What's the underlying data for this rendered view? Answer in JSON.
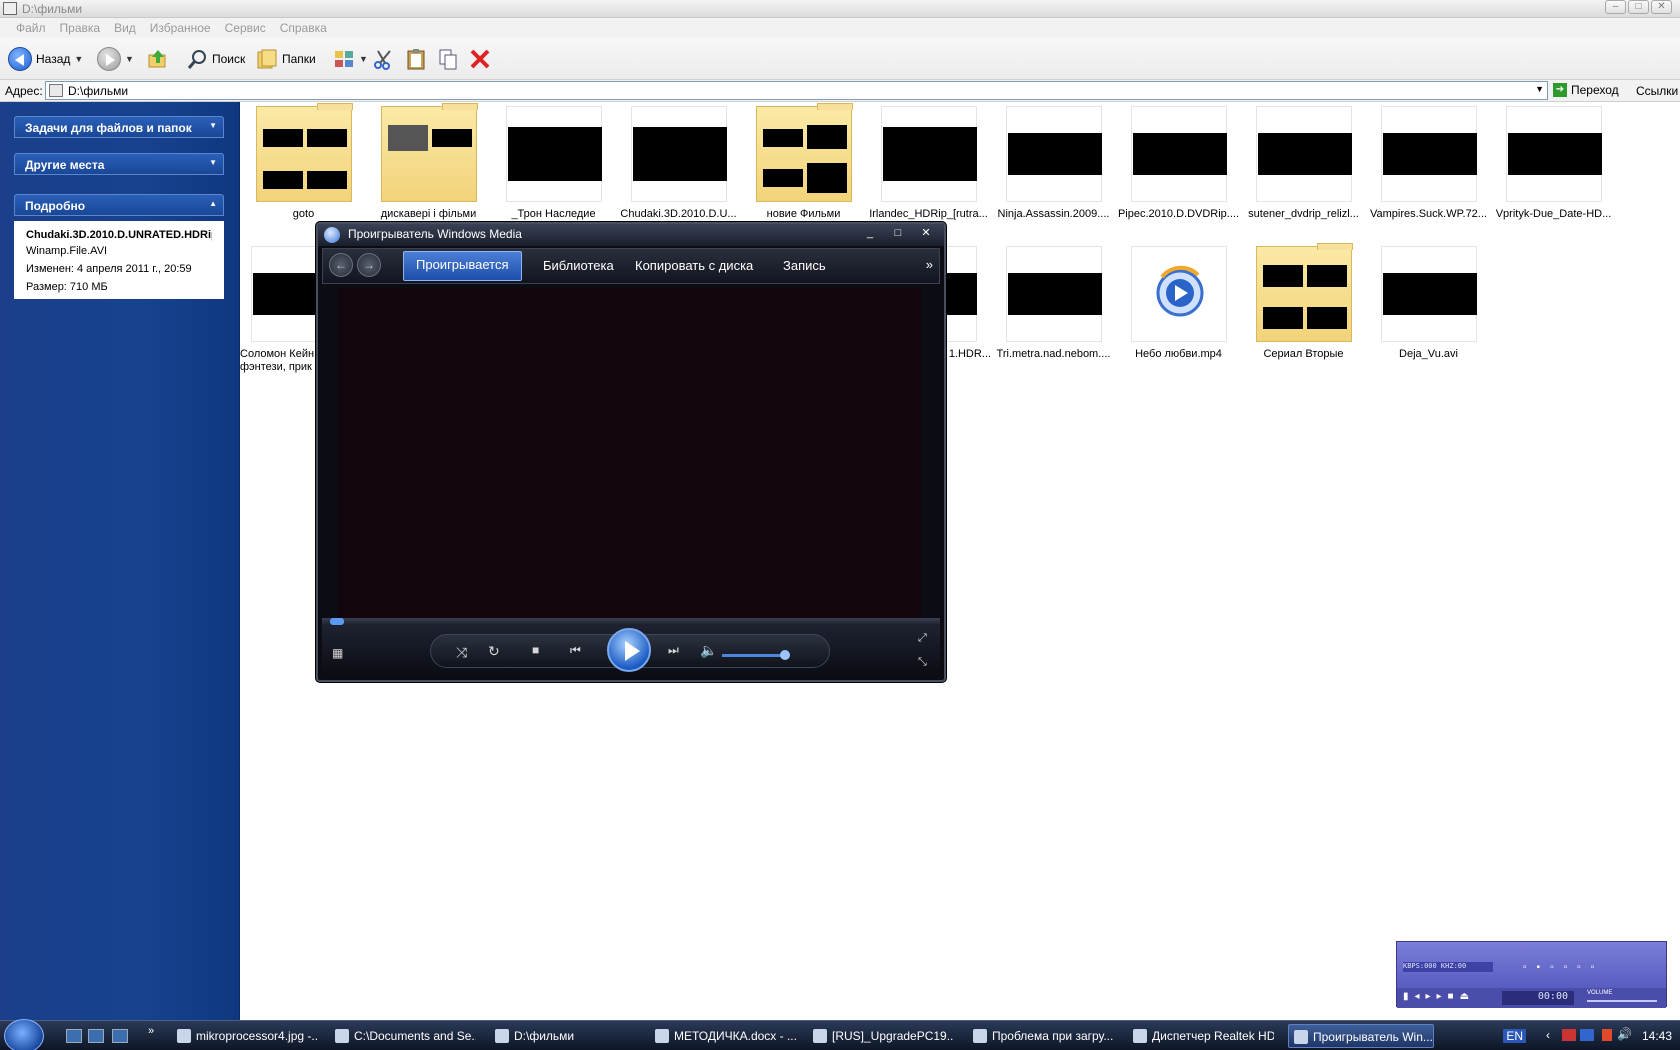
{
  "explorer": {
    "title": "D:\\фильми",
    "menu": [
      "Файл",
      "Правка",
      "Вид",
      "Избранное",
      "Сервис",
      "Справка"
    ],
    "toolbar": {
      "back": "Назад",
      "search": "Поиск",
      "folders": "Папки"
    },
    "address": {
      "label": "Адрес:",
      "value": "D:\\фильми",
      "go": "Переход",
      "links": "Ссылки"
    }
  },
  "taskpane": {
    "sections": [
      "Задачи для файлов и папок",
      "Другие места",
      "Подробно"
    ],
    "details": {
      "name": "Chudaki.3D.2010.D.UNRATED.HDRip",
      "type": "Winamp.File.AVI",
      "modified": "Изменен: 4 апреля 2011 г., 20:59",
      "size": "Размер: 710 МБ"
    }
  },
  "files": [
    {
      "name": "goto",
      "kind": "folder"
    },
    {
      "name": "дискавері і фільми",
      "kind": "folder"
    },
    {
      "name": "_Трон Наследие",
      "kind": "video"
    },
    {
      "name": "Chudaki.3D.2010.D.U...",
      "kind": "video"
    },
    {
      "name": "новие Фильми",
      "kind": "folder"
    },
    {
      "name": "Irlandec_HDRip_[rutra...",
      "kind": "video"
    },
    {
      "name": "Ninja.Assassin.2009....",
      "kind": "video"
    },
    {
      "name": "Pipec.2010.D.DVDRip....",
      "kind": "video"
    },
    {
      "name": "sutener_dvdrip_relizl...",
      "kind": "video"
    },
    {
      "name": "Vampires.Suck.WP.72...",
      "kind": "video"
    },
    {
      "name": "Vprityk-Due_Date-HD...",
      "kind": "video"
    },
    {
      "name": "Соломон Кейн фэнтези, прик",
      "kind": "video"
    },
    {
      "name": "1.HDR...",
      "kind": "video"
    },
    {
      "name": "Tri.metra.nad.nebom....",
      "kind": "video"
    },
    {
      "name": "Небо любви.mp4",
      "kind": "wmp"
    },
    {
      "name": "Сериал Вторые",
      "kind": "folder"
    },
    {
      "name": "Deja_Vu.avi",
      "kind": "video"
    }
  ],
  "wmp": {
    "title": "Проигрыватель Windows Media",
    "tabs": [
      "Проигрывается",
      "Библиотека",
      "Копировать с диска",
      "Запись"
    ],
    "more": "»"
  },
  "winamp": {
    "lcd": "KBPS:000 KHZ:00",
    "time": "00:00",
    "volume": "VOLUME"
  },
  "taskbar": {
    "buttons": [
      "mikroprocessor4.jpg -...",
      "C:\\Documents and Se...",
      "D:\\фильми",
      "МЕТОДИЧКА.docx - ...",
      "[RUS]_UpgradePC19....",
      "Проблема при загру...",
      "Диспетчер Realtek HD",
      "Проигрыватель Win..."
    ],
    "lang": "EN",
    "clock": "14:43"
  }
}
